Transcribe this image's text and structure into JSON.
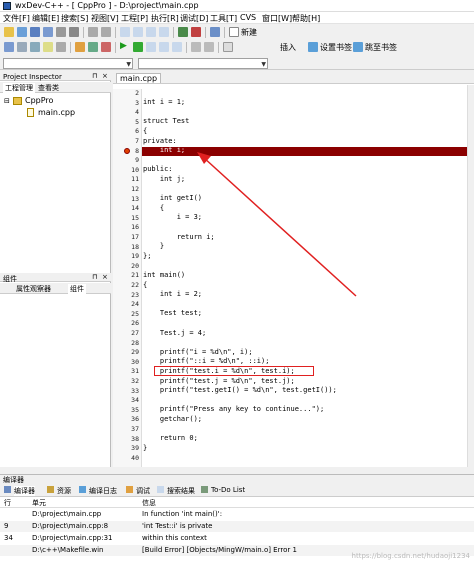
{
  "window": {
    "title": "wxDev-C++ - [ CppPro ] - D:\\project\\main.cpp"
  },
  "menu": [
    "文件[F]",
    "编辑[E]",
    "搜索[S]",
    "视图[V]",
    "工程[P]",
    "执行[R]",
    "调试[D]",
    "工具[T]",
    "CVS",
    "窗口[W]",
    "帮助[H]"
  ],
  "toolbar": {
    "new_label": "新建",
    "insert_label": "插入",
    "set_bookmark_label": "设置书签",
    "goto_bookmark_label": "跳至书签"
  },
  "project_inspector": {
    "title": "Project Inspector",
    "tabs": [
      "工程管理",
      "查看类"
    ],
    "tree": {
      "project": "CppPro",
      "file": "main.cpp"
    }
  },
  "components_panel": {
    "title": "组件",
    "tabs": [
      "属性观察器",
      "组件"
    ]
  },
  "editor": {
    "tab": "main.cpp",
    "lines": [
      {
        "n": "2",
        "t": ""
      },
      {
        "n": "3",
        "t": "int i = 1;"
      },
      {
        "n": "4",
        "t": ""
      },
      {
        "n": "5",
        "t": "struct Test"
      },
      {
        "n": "6",
        "t": "{"
      },
      {
        "n": "7",
        "t": "private:"
      },
      {
        "n": "8",
        "t": "    int i;"
      },
      {
        "n": "9",
        "t": ""
      },
      {
        "n": "10",
        "t": "public:"
      },
      {
        "n": "11",
        "t": "    int j;"
      },
      {
        "n": "12",
        "t": ""
      },
      {
        "n": "13",
        "t": "    int getI()"
      },
      {
        "n": "14",
        "t": "    {"
      },
      {
        "n": "15",
        "t": "        i = 3;"
      },
      {
        "n": "16",
        "t": ""
      },
      {
        "n": "17",
        "t": "        return i;"
      },
      {
        "n": "18",
        "t": "    }"
      },
      {
        "n": "19",
        "t": "};"
      },
      {
        "n": "20",
        "t": ""
      },
      {
        "n": "21",
        "t": "int main()"
      },
      {
        "n": "22",
        "t": "{"
      },
      {
        "n": "23",
        "t": "    int i = 2;"
      },
      {
        "n": "24",
        "t": ""
      },
      {
        "n": "25",
        "t": "    Test test;"
      },
      {
        "n": "26",
        "t": ""
      },
      {
        "n": "27",
        "t": "    Test.j = 4;"
      },
      {
        "n": "28",
        "t": ""
      },
      {
        "n": "29",
        "t": "    printf(\"i = %d\\n\", i);"
      },
      {
        "n": "30",
        "t": "    printf(\"::i = %d\\n\", ::i);"
      },
      {
        "n": "31",
        "t": "    printf(\"test.i = %d\\n\", test.i);"
      },
      {
        "n": "32",
        "t": "    printf(\"test.j = %d\\n\", test.j);"
      },
      {
        "n": "33",
        "t": "    printf(\"test.getI() = %d\\n\", test.getI());"
      },
      {
        "n": "34",
        "t": ""
      },
      {
        "n": "35",
        "t": "    printf(\"Press any key to continue...\");"
      },
      {
        "n": "36",
        "t": "    getchar();"
      },
      {
        "n": "37",
        "t": ""
      },
      {
        "n": "38",
        "t": "    return 0;"
      },
      {
        "n": "39",
        "t": "}"
      },
      {
        "n": "40",
        "t": ""
      }
    ]
  },
  "compiler": {
    "title": "编译器",
    "tabs": [
      "编译器",
      "资源",
      "编译日志",
      "调试",
      "搜索结果",
      "To-Do List"
    ],
    "headers": [
      "行",
      "单元",
      "信息"
    ],
    "rows": [
      {
        "line": "",
        "unit": "D:\\project\\main.cpp",
        "msg": "In function 'int main()':"
      },
      {
        "line": "9",
        "unit": "D:\\project\\main.cpp:8",
        "msg": "'int Test::i' is private"
      },
      {
        "line": "34",
        "unit": "D:\\project\\main.cpp:31",
        "msg": "within this context"
      },
      {
        "line": "",
        "unit": "D:\\c++\\Makefile.win",
        "msg": "[Build Error]  [Objects/MingW/main.o] Error 1"
      }
    ],
    "watermark": "https://blog.csdn.net/hudaoji1234"
  },
  "colors": {
    "highlight": "#8b0000",
    "annotation": "#e02020"
  }
}
